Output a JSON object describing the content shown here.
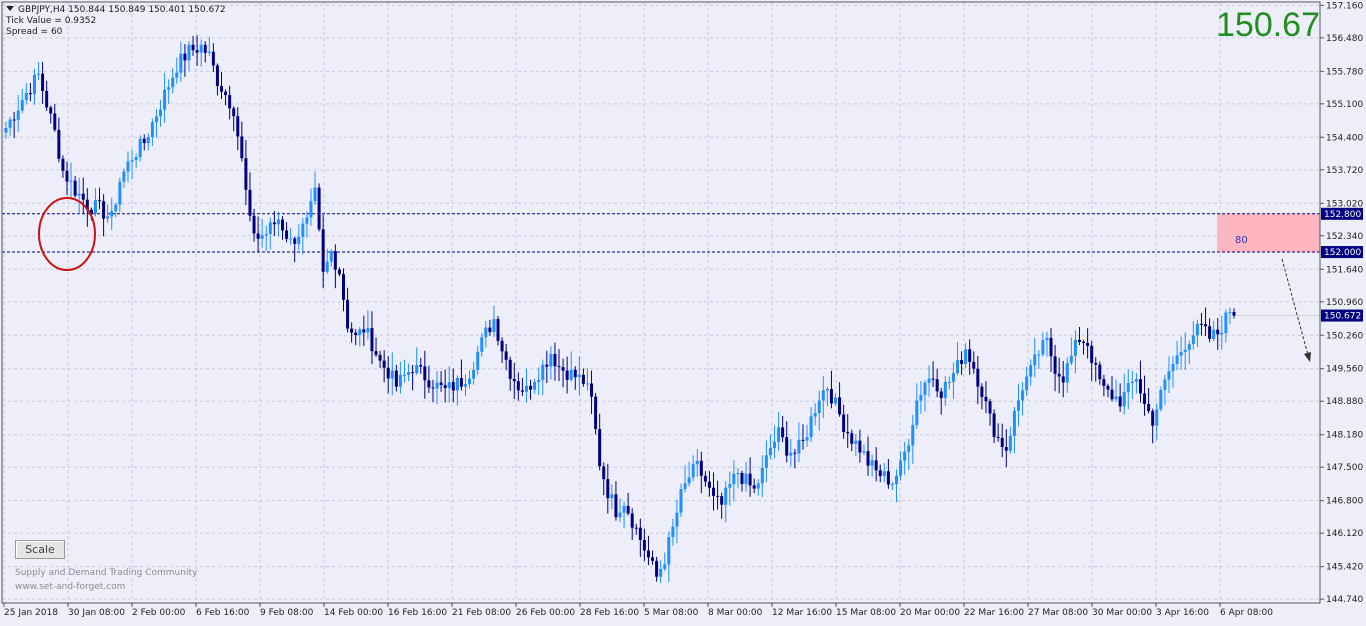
{
  "info": {
    "symbol_line": "GBPJPY,H4  150.844 150.849 150.401 150.672",
    "tick_value": "Tick Value = 0.9352",
    "spread": "Spread = 60"
  },
  "big_price": "150.67",
  "scale_button": "Scale",
  "watermark": {
    "line1": "Supply and Demand Trading Community",
    "line2": "www.set-and-forget.com"
  },
  "zone_label": "80",
  "colors": {
    "background": "#eeeefa",
    "bull_candle": "#1e90ff",
    "bear_candle": "#000080",
    "zone_fill": "#ffb6c1",
    "level_line": "#000080",
    "price_text": "#1f8f1f",
    "circle": "#cc1111"
  },
  "chart_data": {
    "type": "candlestick",
    "symbol": "GBPJPY",
    "timeframe": "H4",
    "ylim": [
      144.66,
      157.23
    ],
    "y_ticks": [
      "157.160",
      "156.480",
      "155.780",
      "155.100",
      "154.400",
      "153.720",
      "153.020",
      "152.340",
      "151.640",
      "150.960",
      "150.260",
      "149.560",
      "148.880",
      "148.180",
      "147.500",
      "146.800",
      "146.120",
      "145.420",
      "144.740"
    ],
    "x_ticks": [
      "25 Jan 2018",
      "30 Jan 08:00",
      "2 Feb 00:00",
      "6 Feb 16:00",
      "9 Feb 08:00",
      "14 Feb 00:00",
      "16 Feb 16:00",
      "21 Feb 08:00",
      "26 Feb 00:00",
      "28 Feb 16:00",
      "5 Mar 08:00",
      "8 Mar 00:00",
      "12 Mar 16:00",
      "15 Mar 08:00",
      "20 Mar 00:00",
      "22 Mar 16:00",
      "27 Mar 08:00",
      "30 Mar 00:00",
      "3 Apr 16:00",
      "6 Apr 08:00"
    ],
    "levels": [
      {
        "price": 152.8,
        "label": "152.800"
      },
      {
        "price": 152.0,
        "label": "152.000"
      }
    ],
    "current_price": {
      "price": 150.672,
      "label": "150.672"
    },
    "zone": {
      "high": 152.8,
      "low": 152.0
    },
    "anchors": [
      [
        0,
        154.6
      ],
      [
        4,
        155.2
      ],
      [
        8,
        155.7
      ],
      [
        12,
        154.5
      ],
      [
        14,
        153.7
      ],
      [
        17,
        153.3
      ],
      [
        20,
        153.0
      ],
      [
        23,
        152.9
      ],
      [
        26,
        152.7
      ],
      [
        28,
        153.5
      ],
      [
        31,
        154.0
      ],
      [
        34,
        154.3
      ],
      [
        36,
        154.7
      ],
      [
        39,
        155.3
      ],
      [
        42,
        155.9
      ],
      [
        45,
        156.2
      ],
      [
        48,
        156.3
      ],
      [
        50,
        156.1
      ],
      [
        52,
        155.6
      ],
      [
        56,
        155.0
      ],
      [
        58,
        153.9
      ],
      [
        60,
        152.6
      ],
      [
        62,
        152.3
      ],
      [
        64,
        152.4
      ],
      [
        67,
        152.7
      ],
      [
        70,
        152.2
      ],
      [
        74,
        152.6
      ],
      [
        76,
        153.2
      ],
      [
        78,
        151.5
      ],
      [
        80,
        152.0
      ],
      [
        82,
        151.6
      ],
      [
        84,
        150.5
      ],
      [
        86,
        150.2
      ],
      [
        88,
        150.4
      ],
      [
        90,
        150.1
      ],
      [
        92,
        149.7
      ],
      [
        94,
        149.5
      ],
      [
        96,
        149.2
      ],
      [
        98,
        149.4
      ],
      [
        100,
        149.6
      ],
      [
        103,
        149.4
      ],
      [
        106,
        149.2
      ],
      [
        108,
        149.1
      ],
      [
        110,
        149.2
      ],
      [
        112,
        149.3
      ],
      [
        114,
        149.5
      ],
      [
        116,
        149.9
      ],
      [
        118,
        150.3
      ],
      [
        120,
        150.6
      ],
      [
        122,
        150.0
      ],
      [
        124,
        149.5
      ],
      [
        126,
        149.2
      ],
      [
        128,
        149.1
      ],
      [
        130,
        149.4
      ],
      [
        132,
        149.6
      ],
      [
        134,
        149.9
      ],
      [
        136,
        149.6
      ],
      [
        138,
        149.5
      ],
      [
        140,
        149.4
      ],
      [
        142,
        149.3
      ],
      [
        144,
        148.9
      ],
      [
        146,
        147.6
      ],
      [
        148,
        147.0
      ],
      [
        150,
        146.6
      ],
      [
        152,
        146.8
      ],
      [
        154,
        146.4
      ],
      [
        156,
        146.0
      ],
      [
        158,
        145.6
      ],
      [
        160,
        145.2
      ],
      [
        162,
        145.6
      ],
      [
        164,
        146.2
      ],
      [
        166,
        146.9
      ],
      [
        168,
        147.3
      ],
      [
        170,
        147.5
      ],
      [
        172,
        147.2
      ],
      [
        174,
        146.8
      ],
      [
        176,
        146.7
      ],
      [
        178,
        147.1
      ],
      [
        180,
        147.4
      ],
      [
        182,
        147.2
      ],
      [
        184,
        147.0
      ],
      [
        186,
        147.4
      ],
      [
        188,
        147.9
      ],
      [
        190,
        148.2
      ],
      [
        192,
        147.9
      ],
      [
        194,
        147.8
      ],
      [
        196,
        148.0
      ],
      [
        198,
        148.5
      ],
      [
        200,
        149.0
      ],
      [
        202,
        149.2
      ],
      [
        204,
        148.8
      ],
      [
        206,
        148.4
      ],
      [
        208,
        148.1
      ],
      [
        210,
        147.9
      ],
      [
        212,
        147.6
      ],
      [
        214,
        147.4
      ],
      [
        216,
        147.3
      ],
      [
        218,
        147.2
      ],
      [
        220,
        147.5
      ],
      [
        222,
        148.1
      ],
      [
        224,
        148.9
      ],
      [
        226,
        149.3
      ],
      [
        228,
        149.4
      ],
      [
        230,
        149.1
      ],
      [
        232,
        149.3
      ],
      [
        234,
        149.6
      ],
      [
        236,
        150.0
      ],
      [
        238,
        149.6
      ],
      [
        240,
        149.1
      ],
      [
        242,
        148.5
      ],
      [
        244,
        148.1
      ],
      [
        246,
        147.9
      ],
      [
        248,
        148.6
      ],
      [
        250,
        149.2
      ],
      [
        252,
        149.5
      ],
      [
        254,
        149.9
      ],
      [
        256,
        150.1
      ],
      [
        258,
        149.6
      ],
      [
        260,
        149.4
      ],
      [
        262,
        149.8
      ],
      [
        264,
        150.2
      ],
      [
        266,
        150.1
      ],
      [
        268,
        149.5
      ],
      [
        270,
        149.1
      ],
      [
        272,
        149.0
      ],
      [
        274,
        148.9
      ],
      [
        276,
        149.1
      ],
      [
        278,
        149.4
      ],
      [
        280,
        148.8
      ],
      [
        282,
        148.5
      ],
      [
        284,
        149.0
      ],
      [
        286,
        149.5
      ],
      [
        288,
        149.8
      ],
      [
        290,
        150.1
      ],
      [
        292,
        150.3
      ],
      [
        294,
        150.4
      ],
      [
        296,
        150.2
      ],
      [
        298,
        150.3
      ],
      [
        300,
        150.6
      ],
      [
        301,
        150.8
      ],
      [
        302,
        150.67
      ]
    ]
  }
}
